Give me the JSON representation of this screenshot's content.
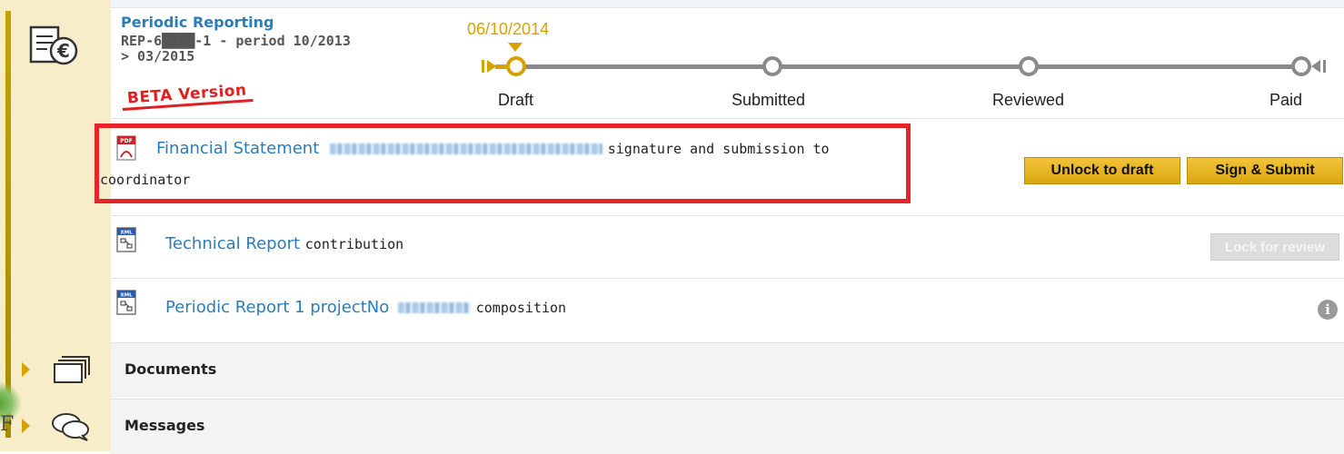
{
  "report": {
    "title": "Periodic Reporting",
    "subtitle_line1": "REP-6████-1 - period 10/2013",
    "subtitle_line2": "> 03/2015",
    "beta_label": "BETA Version"
  },
  "timeline": {
    "current_date": "06/10/2014",
    "steps": [
      {
        "label": "Draft",
        "active": true
      },
      {
        "label": "Submitted",
        "active": false
      },
      {
        "label": "Reviewed",
        "active": false
      },
      {
        "label": "Paid",
        "active": false
      }
    ]
  },
  "documents": [
    {
      "icon": "pdf-icon",
      "title": "Financial Statement",
      "description_line1": "signature and submission to",
      "description_line2": "coordinator",
      "actions": [
        "Unlock to draft",
        "Sign & Submit"
      ]
    },
    {
      "icon": "xml-doc-icon",
      "title": "Technical Report",
      "description": "contribution",
      "actions": [
        "Lock for review"
      ]
    },
    {
      "icon": "xml-doc-icon",
      "title": "Periodic Report 1 projectNo",
      "description": "composition",
      "actions": []
    }
  ],
  "sections": [
    {
      "label": "Documents",
      "icon": "folder-icon"
    },
    {
      "label": "Messages",
      "icon": "speech-bubbles-icon"
    }
  ],
  "colors": {
    "accent_gold": "#d7a200",
    "link_blue": "#2a7db8",
    "highlight_red": "#e8242b",
    "beta_red": "#e02020"
  }
}
